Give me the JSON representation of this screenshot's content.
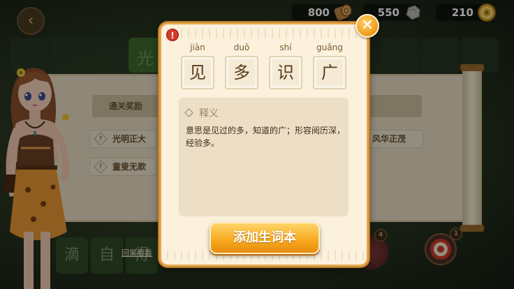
{
  "currencies": [
    {
      "value": "800",
      "icon": "wood-log-icon"
    },
    {
      "value": "550",
      "icon": "stone-icon"
    },
    {
      "value": "210",
      "icon": "gold-coin-icon"
    }
  ],
  "background": {
    "top_tile_char": "光",
    "reward_label": "通关奖励",
    "idioms": [
      "光明正大",
      "童叟无欺",
      "风华正茂"
    ],
    "bottom_chars": [
      "滴",
      "自",
      "得"
    ],
    "go_home_label": "回家看看",
    "tool_badges": [
      "4",
      "1"
    ]
  },
  "modal": {
    "characters": [
      {
        "pinyin": "jiàn",
        "char": "见"
      },
      {
        "pinyin": "duō",
        "char": "多"
      },
      {
        "pinyin": "shí",
        "char": "识"
      },
      {
        "pinyin": "guǎng",
        "char": "广"
      }
    ],
    "definition_title": "释义",
    "definition_text": "意思是见过的多，知道的广；形容阅历深，经验多。",
    "add_button_label": "添加生词本"
  },
  "colors": {
    "accent_orange": "#f7a81c",
    "modal_bg": "#fbf1dc",
    "warn_red": "#d33b2c"
  }
}
